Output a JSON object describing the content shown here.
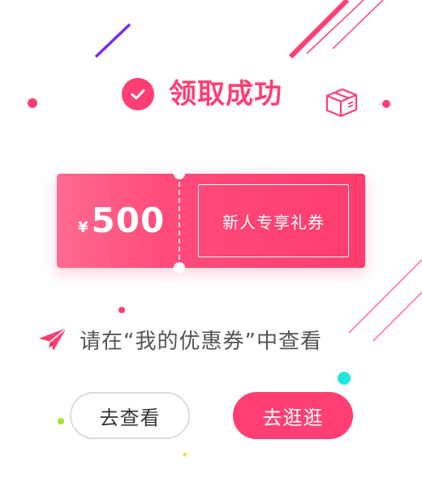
{
  "modal": {
    "title": "领取成功",
    "coupon": {
      "currency": "¥",
      "amount": "500",
      "label": "新人专享礼券"
    },
    "message": "请在“我的优惠券”中查看",
    "buttons": {
      "view": "去查看",
      "shop": "去逛逛"
    }
  },
  "icons": {
    "success": "check-icon",
    "gift_box": "box-icon",
    "hint": "paper-plane-icon"
  },
  "colors": {
    "accent": "#ff3f73",
    "accent_light": "#ff6a90",
    "text_secondary": "#555555",
    "button_border": "#dcdcdc",
    "purple": "#7b2cf4",
    "cyan": "#1ee7dc",
    "lime": "#a6e22e"
  }
}
